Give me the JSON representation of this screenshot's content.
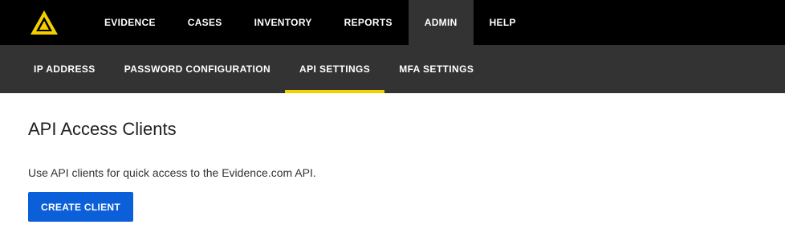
{
  "brand": {
    "logo_icon": "axon-delta-logo-icon",
    "logo_color": "#f5d000"
  },
  "topnav": {
    "items": [
      {
        "label": "EVIDENCE"
      },
      {
        "label": "CASES"
      },
      {
        "label": "INVENTORY"
      },
      {
        "label": "REPORTS"
      },
      {
        "label": "ADMIN",
        "active": true
      },
      {
        "label": "HELP"
      }
    ]
  },
  "subnav": {
    "items": [
      {
        "label": "IP ADDRESS"
      },
      {
        "label": "PASSWORD CONFIGURATION"
      },
      {
        "label": "API SETTINGS",
        "active": true
      },
      {
        "label": "MFA SETTINGS"
      }
    ],
    "active_indicator_color": "#f5d000"
  },
  "main": {
    "title": "API Access Clients",
    "description": "Use API clients for quick access to the Evidence.com API.",
    "create_button_label": "CREATE CLIENT",
    "create_button_color": "#0b5fd8"
  }
}
